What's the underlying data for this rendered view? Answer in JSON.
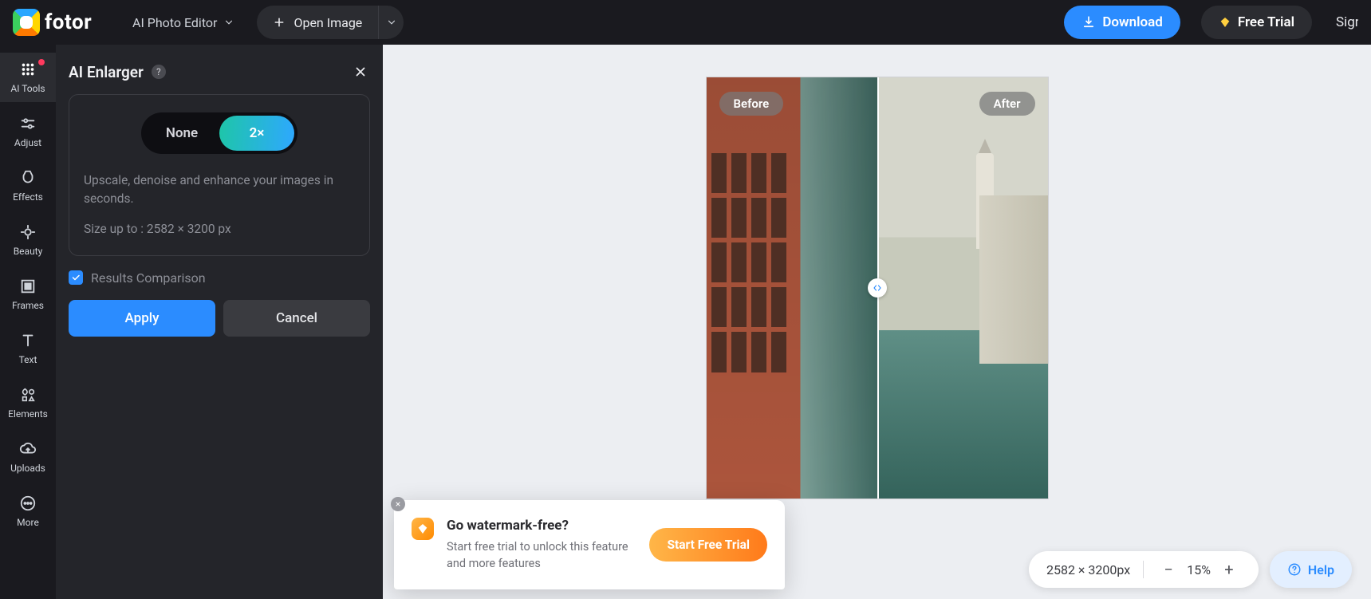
{
  "header": {
    "brand": "fotor",
    "editor_dropdown": "AI Photo Editor",
    "open_image": "Open Image",
    "download": "Download",
    "free_trial": "Free Trial",
    "signin": "Sign In"
  },
  "rail": {
    "items": [
      {
        "icon": "ai-tools-icon",
        "label": "AI Tools",
        "active": true,
        "notify": true
      },
      {
        "icon": "adjust-icon",
        "label": "Adjust"
      },
      {
        "icon": "effects-icon",
        "label": "Effects"
      },
      {
        "icon": "beauty-icon",
        "label": "Beauty"
      },
      {
        "icon": "frames-icon",
        "label": "Frames"
      },
      {
        "icon": "text-icon",
        "label": "Text"
      },
      {
        "icon": "elements-icon",
        "label": "Elements"
      },
      {
        "icon": "uploads-icon",
        "label": "Uploads"
      },
      {
        "icon": "more-icon",
        "label": "More"
      }
    ]
  },
  "panel": {
    "title": "AI Enlarger",
    "seg_none": "None",
    "seg_2x": "2×",
    "desc": "Upscale, denoise and enhance your images in seconds.",
    "size_line": "Size up to : 2582 × 3200 px",
    "results_comparison_label": "Results Comparison",
    "results_comparison_checked": true,
    "apply": "Apply",
    "cancel": "Cancel"
  },
  "canvas": {
    "before_label": "Before",
    "after_label": "After"
  },
  "watermark_popup": {
    "title": "Go watermark-free?",
    "sub": "Start free trial to unlock this feature and more features",
    "cta": "Start Free Trial"
  },
  "footer": {
    "size_text": "2582 × 3200px",
    "zoom_text": "15%",
    "help": "Help"
  }
}
